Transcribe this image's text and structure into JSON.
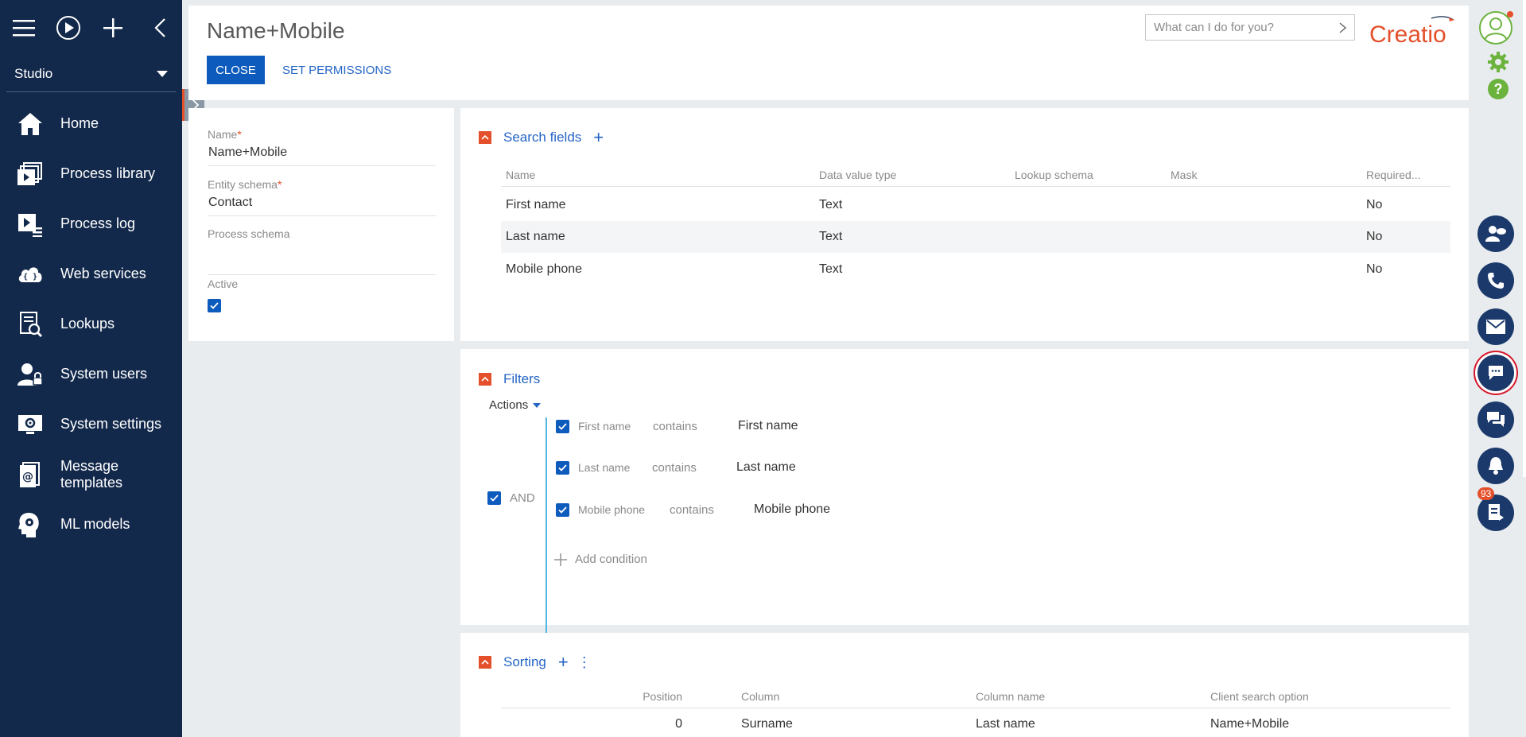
{
  "sidebar": {
    "workplace": "Studio",
    "items": [
      {
        "label": "Home",
        "icon": "home-icon"
      },
      {
        "label": "Process library",
        "icon": "process-library-icon"
      },
      {
        "label": "Process log",
        "icon": "process-log-icon"
      },
      {
        "label": "Web services",
        "icon": "web-services-icon"
      },
      {
        "label": "Lookups",
        "icon": "lookups-icon"
      },
      {
        "label": "System users",
        "icon": "system-users-icon"
      },
      {
        "label": "System settings",
        "icon": "system-settings-icon"
      },
      {
        "label": "Message templates",
        "icon": "message-templates-icon"
      },
      {
        "label": "ML models",
        "icon": "ml-models-icon"
      }
    ]
  },
  "header": {
    "title": "Name+Mobile",
    "close_label": "CLOSE",
    "permissions_label": "SET PERMISSIONS",
    "search_placeholder": "What can I do for you?",
    "logo_text": "Creatio"
  },
  "details": {
    "name_label": "Name",
    "name_value": "Name+Mobile",
    "entity_label": "Entity schema",
    "entity_value": "Contact",
    "process_label": "Process schema",
    "process_value": "",
    "active_label": "Active",
    "active_checked": true
  },
  "search_fields": {
    "title": "Search fields",
    "columns": [
      "Name",
      "Data value type",
      "Lookup schema",
      "Mask",
      "Required..."
    ],
    "rows": [
      [
        "First name",
        "Text",
        "",
        "",
        "No"
      ],
      [
        "Last name",
        "Text",
        "",
        "",
        "No"
      ],
      [
        "Mobile phone",
        "Text",
        "",
        "",
        "No"
      ]
    ]
  },
  "filters": {
    "title": "Filters",
    "actions_label": "Actions",
    "group_label": "AND",
    "conditions": [
      {
        "column": "First name",
        "operator": "contains",
        "value": "First name"
      },
      {
        "column": "Last name",
        "operator": "contains",
        "value": "Last name"
      },
      {
        "column": "Mobile phone",
        "operator": "contains",
        "value": "Mobile phone"
      }
    ],
    "add_condition_label": "Add condition"
  },
  "sorting": {
    "title": "Sorting",
    "columns": [
      "Position",
      "Column",
      "Column name",
      "Client search option"
    ],
    "rows": [
      [
        "0",
        "Surname",
        "Last name",
        "Name+Mobile"
      ]
    ]
  },
  "rail": {
    "notifications_count": "93"
  },
  "colors": {
    "sidebar_bg": "#13294b",
    "accent_blue": "#0d5bbd",
    "brand_red": "#e4502b",
    "filter_line": "#4fb7e0"
  }
}
